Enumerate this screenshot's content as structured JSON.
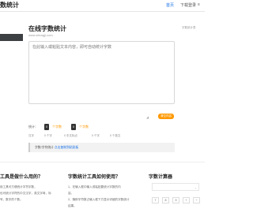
{
  "header": {
    "brand": "数统计",
    "nav_home": "首页",
    "nav_download": "下载登录",
    "nav_menu": "≡"
  },
  "main": {
    "title": "在线字数统计",
    "domain": "www.zitongji.com",
    "top_right_note": "字数统计表",
    "textarea_placeholder": "在此输入或粘贴文本内容，即可自动统计字数",
    "copy_button": "清空内容"
  },
  "stats": {
    "label": "统计：",
    "items": [
      {
        "value": "0",
        "label": "个字数"
      },
      {
        "value": "0",
        "label": "个字数"
      }
    ],
    "sub_items": [
      "汉字",
      "0 个字",
      "0 中文标点",
      "0 个字",
      "0 个英文"
    ]
  },
  "notice": {
    "prefix": "字数/字符统计",
    "link": "点击复制到粘贴板"
  },
  "cards": [
    {
      "title": "工具是做什么用的？",
      "body": [
        "用工具可方便统计字符字数，",
        "也可统计字符的中文汉字，英文字母，标",
        "号，数字的个数。"
      ]
    },
    {
      "title": "字数统计工具如何使用？",
      "body": [
        "1、在输入框中输入或粘贴要统计字数的内",
        "容。",
        "2、随即字符数占输入框下方显示详细的字数统计",
        "结果。"
      ]
    },
    {
      "title": "字数计算器",
      "keys": [
        "7",
        "8",
        "9",
        "+",
        "÷"
      ]
    }
  ],
  "colors": {
    "accent": "#ff9800",
    "link": "#1a73e8",
    "dark": "#333333"
  }
}
